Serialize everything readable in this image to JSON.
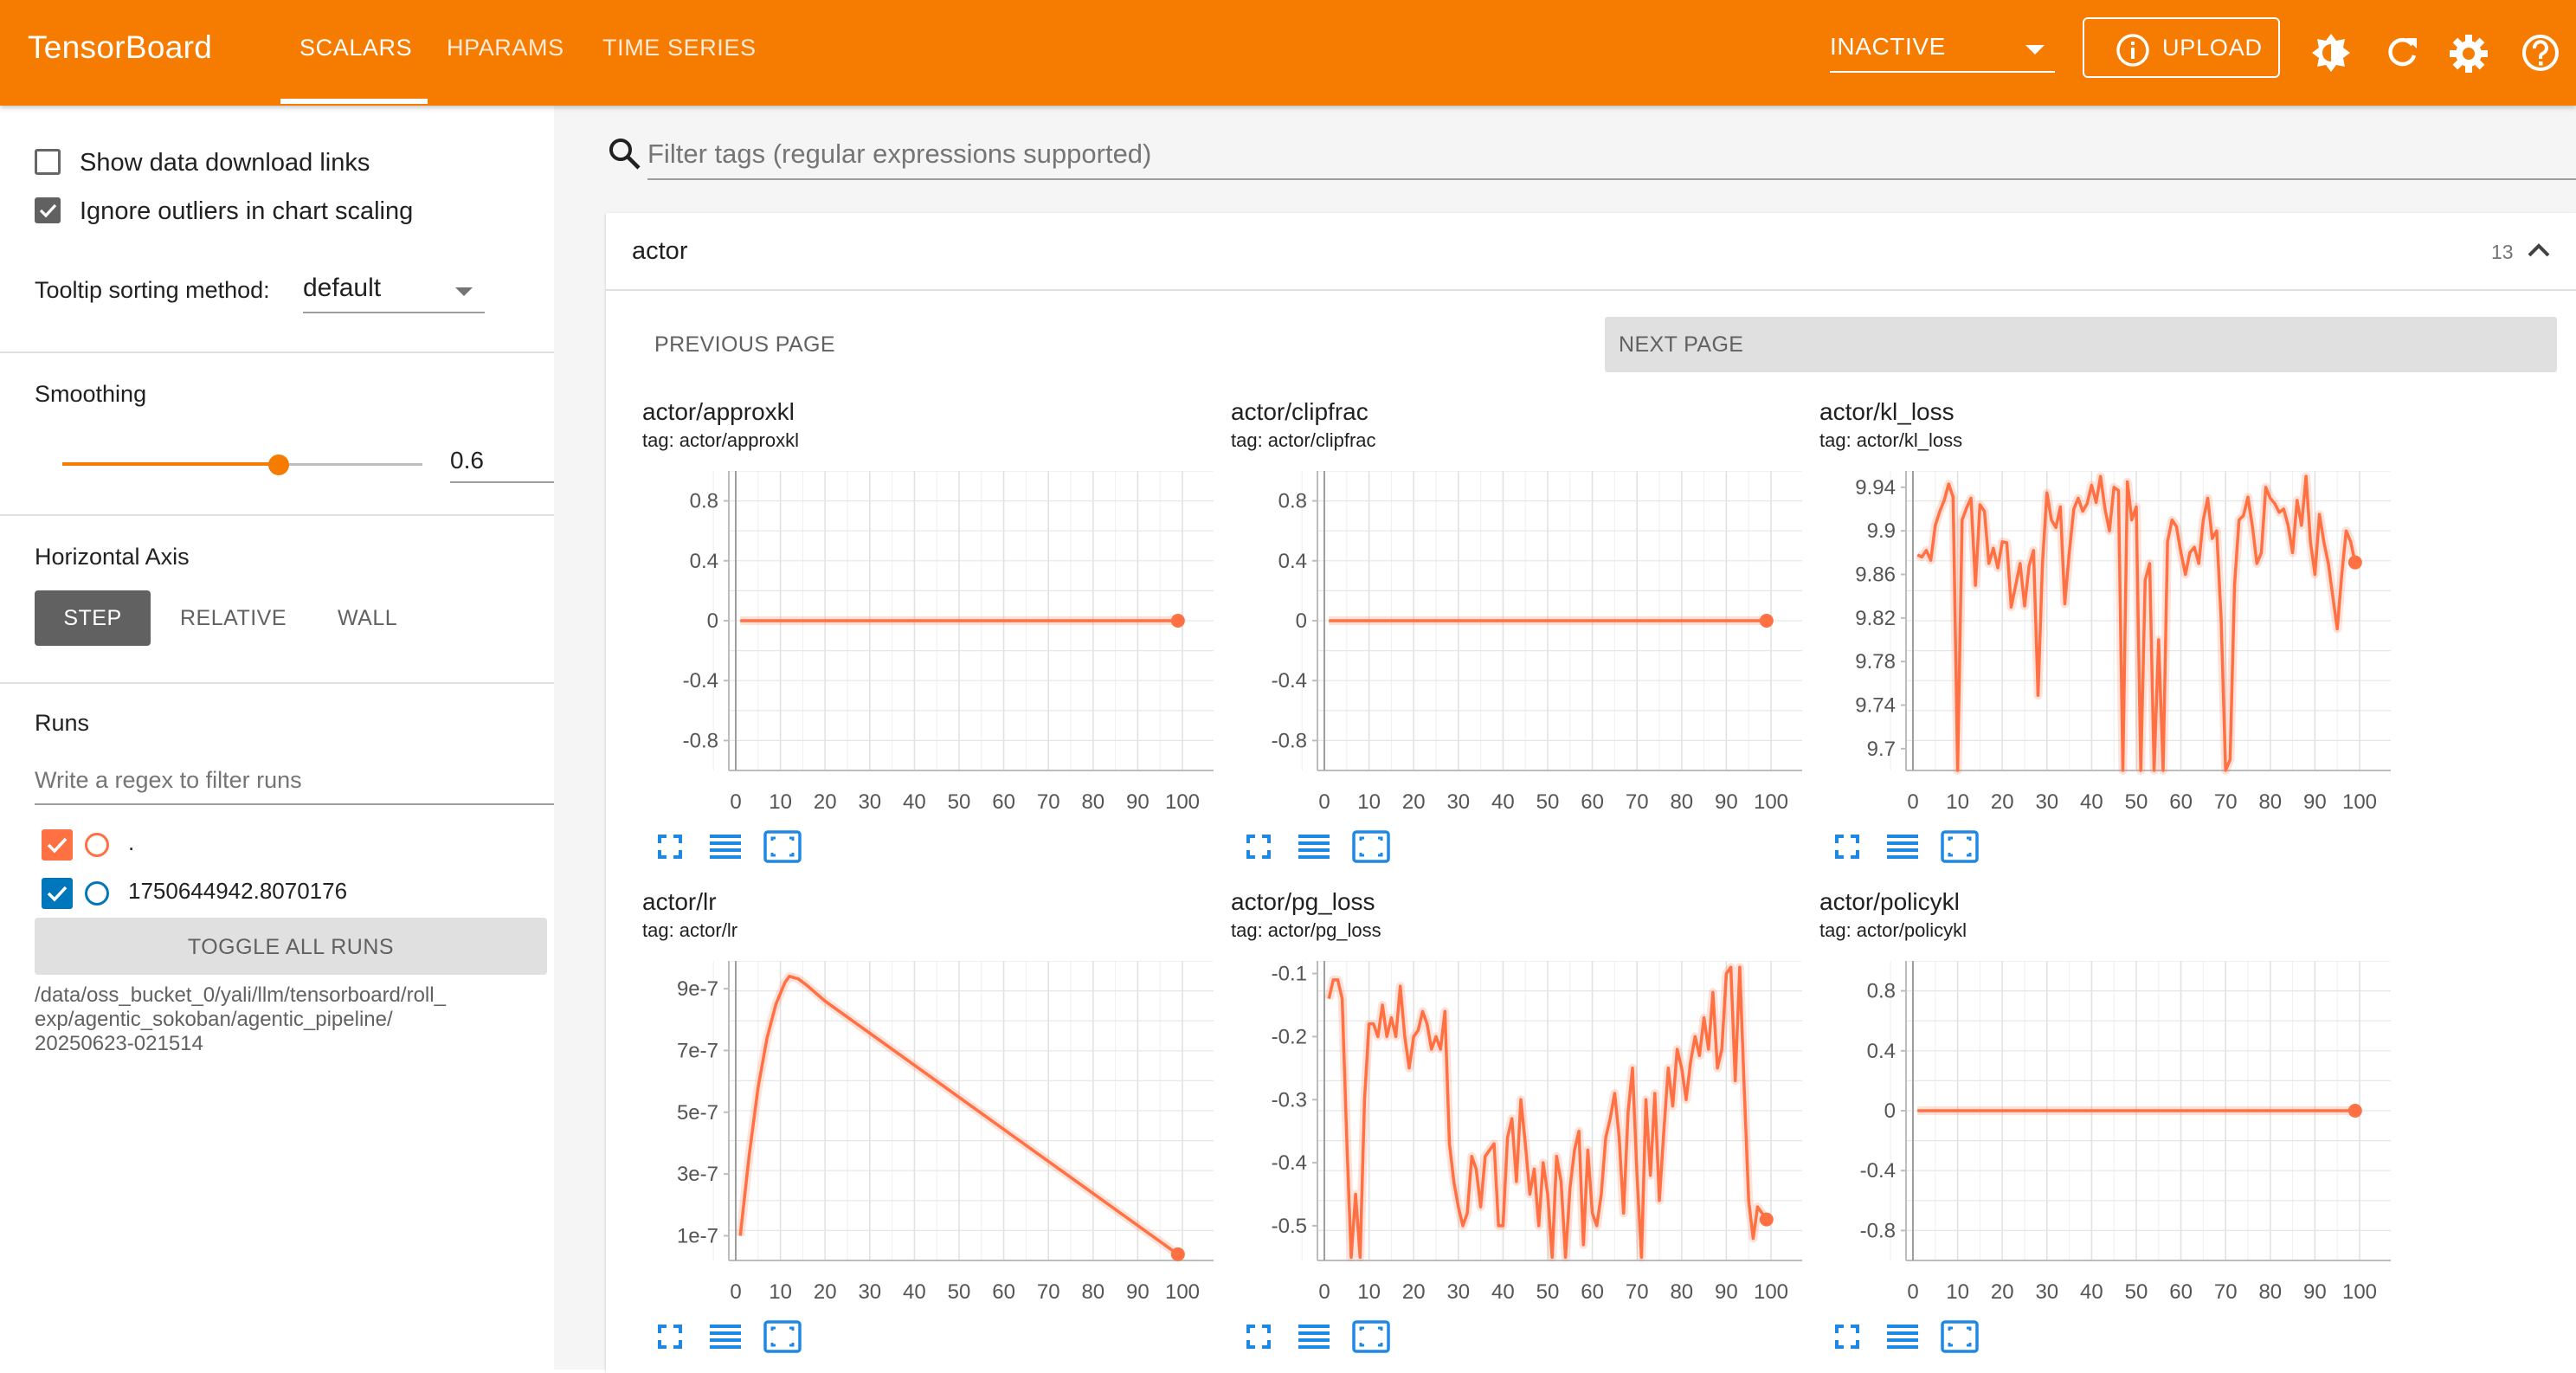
{
  "header": {
    "brand": "TensorBoard",
    "tabs": [
      {
        "label": "SCALARS",
        "active": true
      },
      {
        "label": "HPARAMS",
        "active": false
      },
      {
        "label": "TIME SERIES",
        "active": false
      }
    ],
    "reload_select": "INACTIVE",
    "upload_label": "UPLOAD",
    "icons": [
      "brightness-icon",
      "refresh-icon",
      "settings-icon",
      "help-icon"
    ],
    "accent": "#f57c00"
  },
  "sidebar": {
    "show_download_links": {
      "label": "Show data download links",
      "checked": false
    },
    "ignore_outliers": {
      "label": "Ignore outliers in chart scaling",
      "checked": true
    },
    "tooltip_sorting": {
      "label": "Tooltip sorting method:",
      "value": "default"
    },
    "smoothing": {
      "label": "Smoothing",
      "value": "0.6",
      "slider_fraction": 0.6
    },
    "horizontal_axis": {
      "label": "Horizontal Axis",
      "options": [
        "STEP",
        "RELATIVE",
        "WALL"
      ],
      "selected": "STEP"
    },
    "runs": {
      "label": "Runs",
      "filter_placeholder": "Write a regex to filter runs",
      "items": [
        {
          "name": ".",
          "checked": true,
          "color": "#ff7043"
        },
        {
          "name": "1750644942.8070176",
          "checked": true,
          "color": "#0077bb"
        }
      ],
      "toggle_all": "TOGGLE ALL RUNS",
      "logdir": "/data/oss_bucket_0/yali/llm/tensorboard/roll_\nexp/agentic_sokoban/agentic_pipeline/\n20250623-021514"
    }
  },
  "main": {
    "filter_placeholder": "Filter tags (regular expressions supported)",
    "group": {
      "name": "actor",
      "count": "13"
    },
    "prev_page": "PREVIOUS PAGE",
    "next_page": "NEXT PAGE"
  },
  "chart_data": [
    {
      "type": "line",
      "title": "actor/approxkl",
      "tag": "tag: actor/approxkl",
      "xlim": [
        0,
        100
      ],
      "ylim": [
        -1,
        1
      ],
      "xticks": [
        "0",
        "10",
        "20",
        "30",
        "40",
        "50",
        "60",
        "70",
        "80",
        "90",
        "100"
      ],
      "yticks": [
        "0.8",
        "0.4",
        "0",
        "-0.4",
        "-0.8"
      ],
      "series": [
        {
          "x": [
            1,
            99
          ],
          "y": [
            0,
            0
          ]
        }
      ],
      "end_point": [
        99,
        0
      ]
    },
    {
      "type": "line",
      "title": "actor/clipfrac",
      "tag": "tag: actor/clipfrac",
      "xlim": [
        0,
        100
      ],
      "ylim": [
        -1,
        1
      ],
      "xticks": [
        "0",
        "10",
        "20",
        "30",
        "40",
        "50",
        "60",
        "70",
        "80",
        "90",
        "100"
      ],
      "yticks": [
        "0.8",
        "0.4",
        "0",
        "-0.4",
        "-0.8"
      ],
      "series": [
        {
          "x": [
            1,
            99
          ],
          "y": [
            0,
            0
          ]
        }
      ],
      "end_point": [
        99,
        0
      ]
    },
    {
      "type": "line",
      "title": "actor/kl_loss",
      "tag": "tag: actor/kl_loss",
      "xlim": [
        0,
        100
      ],
      "ylim": [
        9.68,
        9.955
      ],
      "xticks": [
        "0",
        "10",
        "20",
        "30",
        "40",
        "50",
        "60",
        "70",
        "80",
        "90",
        "100"
      ],
      "yticks": [
        "9.94",
        "9.9",
        "9.86",
        "9.82",
        "9.78",
        "9.74",
        "9.7"
      ],
      "series": [
        {
          "x": [
            1,
            2,
            3,
            4,
            5,
            6,
            7,
            8,
            9,
            10,
            11,
            12,
            13,
            14,
            15,
            16,
            17,
            18,
            19,
            20,
            21,
            22,
            23,
            24,
            25,
            26,
            27,
            28,
            29,
            30,
            31,
            32,
            33,
            34,
            35,
            36,
            37,
            38,
            39,
            40,
            41,
            42,
            43,
            44,
            45,
            46,
            47,
            48,
            49,
            50,
            51,
            52,
            53,
            54,
            55,
            56,
            57,
            58,
            59,
            60,
            61,
            62,
            63,
            64,
            65,
            66,
            67,
            68,
            69,
            70,
            71,
            72,
            73,
            74,
            75,
            76,
            77,
            78,
            79,
            80,
            81,
            82,
            83,
            84,
            85,
            86,
            87,
            88,
            89,
            90,
            91,
            92,
            93,
            94,
            95,
            96,
            97,
            98,
            99
          ],
          "y": [
            9.878,
            9.876,
            9.882,
            9.873,
            9.905,
            9.918,
            9.928,
            9.943,
            9.931,
            9.68,
            9.91,
            9.921,
            9.93,
            9.85,
            9.924,
            9.918,
            9.87,
            9.884,
            9.866,
            9.89,
            9.889,
            9.83,
            9.85,
            9.87,
            9.831,
            9.868,
            9.882,
            9.749,
            9.87,
            9.935,
            9.91,
            9.903,
            9.922,
            9.833,
            9.88,
            9.92,
            9.93,
            9.918,
            9.925,
            9.942,
            9.926,
            9.95,
            9.92,
            9.9,
            9.94,
            9.937,
            9.68,
            9.945,
            9.91,
            9.922,
            9.68,
            9.855,
            9.87,
            9.68,
            9.8,
            9.68,
            9.89,
            9.91,
            9.904,
            9.88,
            9.86,
            9.88,
            9.885,
            9.87,
            9.91,
            9.93,
            9.893,
            9.9,
            9.82,
            9.68,
            9.69,
            9.85,
            9.91,
            9.914,
            9.931,
            9.904,
            9.87,
            9.88,
            9.94,
            9.93,
            9.925,
            9.917,
            9.92,
            9.905,
            9.88,
            9.928,
            9.905,
            9.95,
            9.89,
            9.86,
            9.915,
            9.89,
            9.87,
            9.84,
            9.81,
            9.86,
            9.9,
            9.89,
            9.871
          ]
        }
      ],
      "end_point": [
        99,
        9.871
      ]
    },
    {
      "type": "line",
      "title": "actor/lr",
      "tag": "tag: actor/lr",
      "xlim": [
        0,
        100
      ],
      "ylim": [
        2e-08,
        9.9e-07
      ],
      "xticks": [
        "0",
        "10",
        "20",
        "30",
        "40",
        "50",
        "60",
        "70",
        "80",
        "90",
        "100"
      ],
      "yticks": [
        "9e-7",
        "7e-7",
        "5e-7",
        "3e-7",
        "1e-7"
      ],
      "series": [
        {
          "x": [
            1,
            3,
            5,
            7,
            9,
            11,
            12,
            14,
            16,
            18,
            20,
            99
          ],
          "y": [
            1e-07,
            3.6e-07,
            5.8e-07,
            7.4e-07,
            8.5e-07,
            9.2e-07,
            9.4e-07,
            9.32e-07,
            9.1e-07,
            8.85e-07,
            8.6e-07,
            4e-08
          ]
        }
      ],
      "end_point": [
        99,
        4e-08
      ]
    },
    {
      "type": "line",
      "title": "actor/pg_loss",
      "tag": "tag: actor/pg_loss",
      "xlim": [
        0,
        100
      ],
      "ylim": [
        -0.555,
        -0.08
      ],
      "xticks": [
        "0",
        "10",
        "20",
        "30",
        "40",
        "50",
        "60",
        "70",
        "80",
        "90",
        "100"
      ],
      "yticks": [
        "-0.1",
        "-0.2",
        "-0.3",
        "-0.4",
        "-0.5"
      ],
      "series": [
        {
          "x": [
            1,
            2,
            3,
            4,
            5,
            6,
            7,
            8,
            9,
            10,
            11,
            12,
            13,
            14,
            15,
            16,
            17,
            18,
            19,
            20,
            21,
            22,
            23,
            24,
            25,
            26,
            27,
            28,
            29,
            30,
            31,
            32,
            33,
            34,
            35,
            36,
            37,
            38,
            39,
            40,
            41,
            42,
            43,
            44,
            45,
            46,
            47,
            48,
            49,
            50,
            51,
            52,
            53,
            54,
            55,
            56,
            57,
            58,
            59,
            60,
            61,
            62,
            63,
            64,
            65,
            66,
            67,
            68,
            69,
            70,
            71,
            72,
            73,
            74,
            75,
            76,
            77,
            78,
            79,
            80,
            81,
            82,
            83,
            84,
            85,
            86,
            87,
            88,
            89,
            90,
            91,
            92,
            93,
            94,
            95,
            96,
            97,
            98,
            99
          ],
          "y": [
            -0.14,
            -0.11,
            -0.11,
            -0.14,
            -0.36,
            -0.55,
            -0.45,
            -0.55,
            -0.3,
            -0.18,
            -0.18,
            -0.2,
            -0.15,
            -0.2,
            -0.17,
            -0.2,
            -0.12,
            -0.2,
            -0.25,
            -0.2,
            -0.19,
            -0.16,
            -0.18,
            -0.22,
            -0.2,
            -0.22,
            -0.16,
            -0.37,
            -0.43,
            -0.47,
            -0.5,
            -0.48,
            -0.39,
            -0.41,
            -0.47,
            -0.39,
            -0.38,
            -0.37,
            -0.5,
            -0.5,
            -0.36,
            -0.33,
            -0.43,
            -0.3,
            -0.37,
            -0.45,
            -0.41,
            -0.5,
            -0.4,
            -0.45,
            -0.55,
            -0.39,
            -0.43,
            -0.55,
            -0.44,
            -0.38,
            -0.35,
            -0.53,
            -0.38,
            -0.48,
            -0.5,
            -0.45,
            -0.36,
            -0.33,
            -0.29,
            -0.36,
            -0.48,
            -0.32,
            -0.25,
            -0.42,
            -0.55,
            -0.3,
            -0.42,
            -0.29,
            -0.46,
            -0.35,
            -0.25,
            -0.31,
            -0.22,
            -0.25,
            -0.3,
            -0.24,
            -0.2,
            -0.23,
            -0.17,
            -0.22,
            -0.13,
            -0.25,
            -0.22,
            -0.1,
            -0.09,
            -0.27,
            -0.09,
            -0.28,
            -0.46,
            -0.52,
            -0.47,
            -0.48,
            -0.49
          ]
        }
      ],
      "end_point": [
        99,
        -0.49
      ]
    },
    {
      "type": "line",
      "title": "actor/policykl",
      "tag": "tag: actor/policykl",
      "xlim": [
        0,
        100
      ],
      "ylim": [
        -1,
        1
      ],
      "xticks": [
        "0",
        "10",
        "20",
        "30",
        "40",
        "50",
        "60",
        "70",
        "80",
        "90",
        "100"
      ],
      "yticks": [
        "0.8",
        "0.4",
        "0",
        "-0.4",
        "-0.8"
      ],
      "series": [
        {
          "x": [
            1,
            99
          ],
          "y": [
            0,
            0
          ]
        }
      ],
      "end_point": [
        99,
        0
      ]
    }
  ]
}
